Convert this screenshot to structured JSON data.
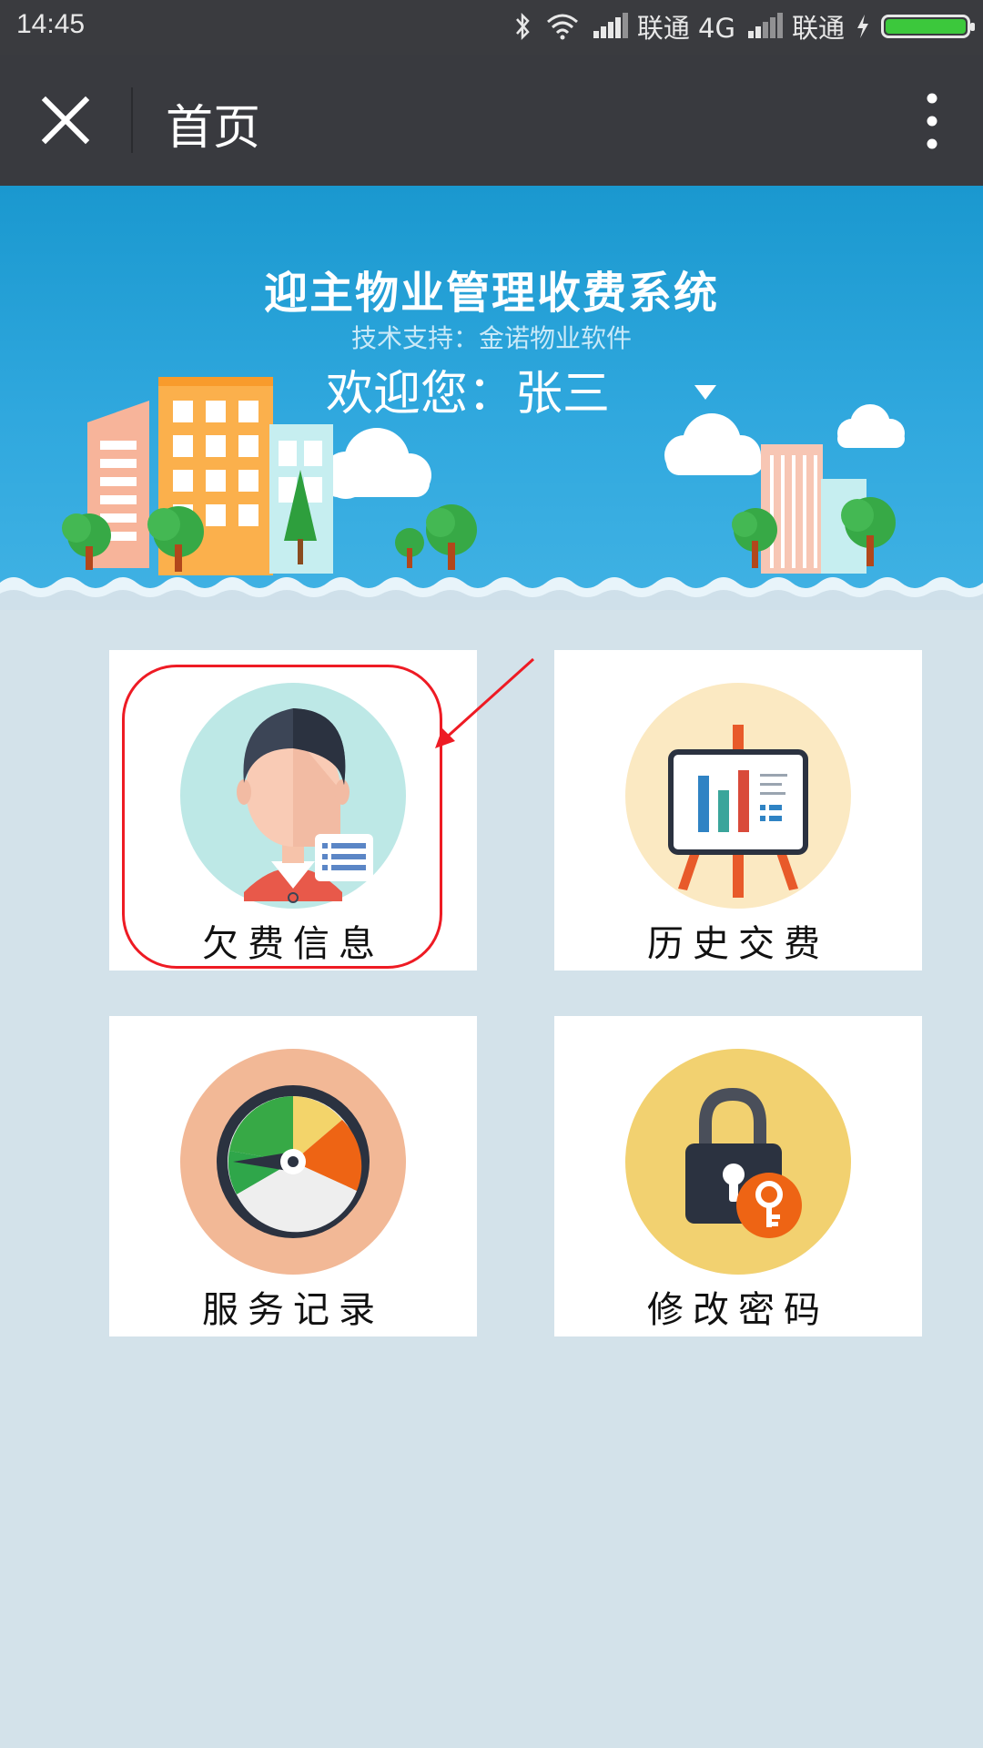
{
  "status_bar": {
    "time": "14:45",
    "carrier1": "联通 4G",
    "carrier2": "联通",
    "icons": [
      "bluetooth-icon",
      "wifi-icon",
      "signal-icon",
      "signal-icon",
      "charging-icon",
      "battery-icon"
    ]
  },
  "titlebar": {
    "title": "首页",
    "close_icon": "close-icon",
    "more_icon": "more-vertical-icon"
  },
  "banner": {
    "system_title": "迎主物业管理收费系统",
    "support_text": "技术支持：金诺物业软件",
    "welcome_text": "欢迎您：张三"
  },
  "tiles": [
    {
      "label": "欠费信息",
      "icon": "user-card-icon",
      "circle_color": "#bde8e6"
    },
    {
      "label": "历史交费",
      "icon": "presentation-chart-icon",
      "circle_color": "#fbe9c2"
    },
    {
      "label": "服务记录",
      "icon": "gauge-icon",
      "circle_color": "#f2b896"
    },
    {
      "label": "修改密码",
      "icon": "lock-key-icon",
      "circle_color": "#f2d170"
    }
  ],
  "annotation": {
    "color": "#ee1b24",
    "target": "欠费信息"
  }
}
